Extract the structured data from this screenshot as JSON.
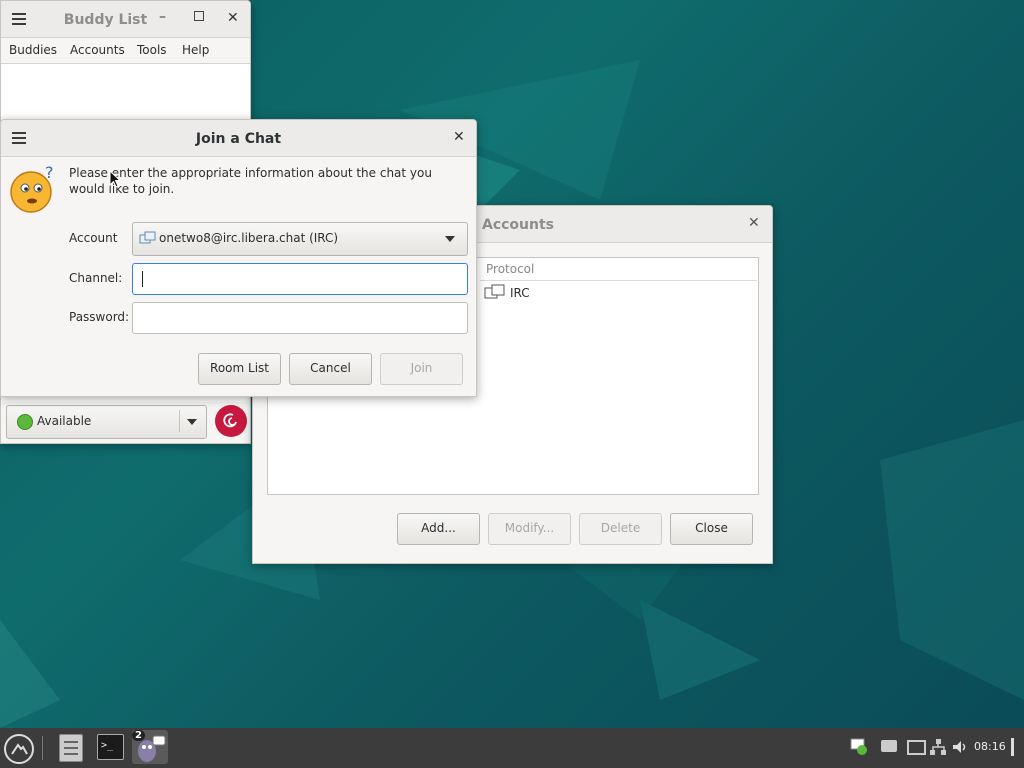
{
  "buddy_list": {
    "title": "Buddy List",
    "menu": [
      "Buddies",
      "Accounts",
      "Tools",
      "Help"
    ],
    "status": "Available"
  },
  "accounts": {
    "title": "Accounts",
    "column_protocol": "Protocol",
    "rows": [
      {
        "protocol": "IRC"
      }
    ],
    "buttons": {
      "add": "Add...",
      "modify": "Modify...",
      "delete": "Delete",
      "close": "Close"
    }
  },
  "join_chat": {
    "title": "Join a Chat",
    "message": "Please enter the appropriate information about the chat you would like to join.",
    "account_label": "Account",
    "account_value": "onetwo8@irc.libera.chat (IRC)",
    "channel_label": "Channel:",
    "channel_value": "",
    "password_label": "Password:",
    "password_value": "",
    "buttons": {
      "room_list": "Room List",
      "cancel": "Cancel",
      "join": "Join"
    }
  },
  "taskbar": {
    "clock": "08:16",
    "badge_count": "2"
  },
  "colors": {
    "desktop": "#0f6c6d",
    "status_green": "#5cb83a",
    "debian_red": "#c7193f",
    "focus_blue": "#3584e4"
  }
}
